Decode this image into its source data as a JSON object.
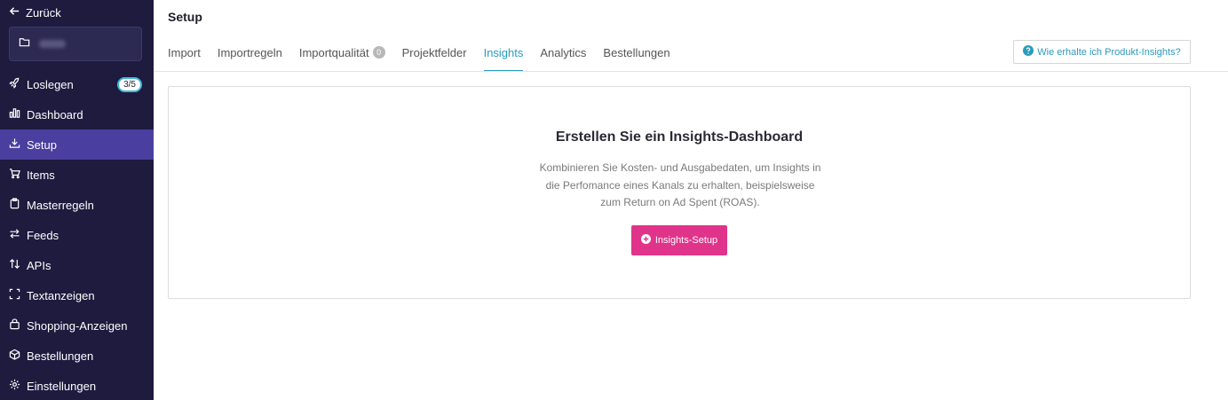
{
  "sidebar": {
    "back_label": "Zurück",
    "items": [
      {
        "label": "Loslegen",
        "icon": "rocket-icon",
        "badge": "3/5"
      },
      {
        "label": "Dashboard",
        "icon": "bar-chart-icon"
      },
      {
        "label": "Setup",
        "icon": "download-icon",
        "active": true
      },
      {
        "label": "Items",
        "icon": "cart-icon"
      },
      {
        "label": "Masterregeln",
        "icon": "clipboard-icon"
      },
      {
        "label": "Feeds",
        "icon": "arrows-icon"
      },
      {
        "label": "APIs",
        "icon": "sort-icon"
      },
      {
        "label": "Textanzeigen",
        "icon": "frame-icon"
      },
      {
        "label": "Shopping-Anzeigen",
        "icon": "bag-icon"
      },
      {
        "label": "Bestellungen",
        "icon": "box-icon"
      },
      {
        "label": "Einstellungen",
        "icon": "gear-icon"
      }
    ]
  },
  "header": {
    "title": "Setup",
    "help_label": "Wie erhalte ich Produkt-Insights?"
  },
  "tabs": [
    {
      "label": "Import"
    },
    {
      "label": "Importregeln"
    },
    {
      "label": "Importqualität",
      "count": "0"
    },
    {
      "label": "Projektfelder"
    },
    {
      "label": "Insights",
      "active": true
    },
    {
      "label": "Analytics"
    },
    {
      "label": "Bestellungen"
    }
  ],
  "card": {
    "title": "Erstellen Sie ein Insights-Dashboard",
    "text_line1": "Kombinieren Sie Kosten- und Ausgabedaten, um Insights in",
    "text_line2": "die Perfomance eines Kanals zu erhalten, beispielsweise",
    "text_line3": "zum Return on Ad Spent (ROAS).",
    "cta_label": "Insights-Setup"
  },
  "colors": {
    "sidebar_bg": "#1e1b3f",
    "active_bg": "#4a3f9e",
    "accent": "#2b9bbd",
    "cta": "#e0338a"
  }
}
